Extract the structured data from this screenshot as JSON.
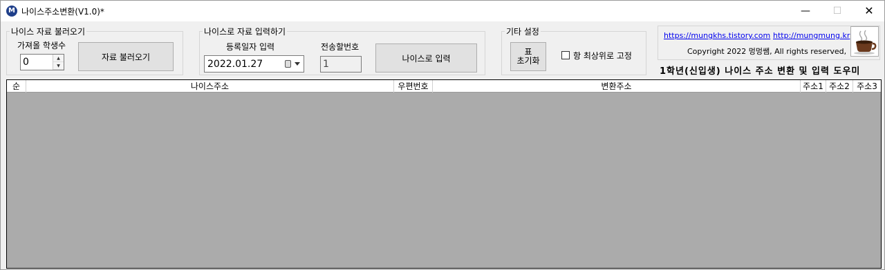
{
  "window": {
    "title": "나이스주소변환(V1.0)*",
    "icon": "app-m-icon"
  },
  "groups": {
    "load": {
      "title": "나이스 자료 불러오기",
      "count_label": "가져올 학생수",
      "count_value": "0",
      "load_button": "자료 불러오기"
    },
    "input": {
      "title": "나이스로 자료 입력하기",
      "date_label": "등록일자 입력",
      "date_value": "2022.01.27",
      "send_label": "전송할번호",
      "send_value": "1",
      "input_button": "나이스로 입력"
    },
    "misc": {
      "title": "기타 설정",
      "reset_button_line1": "표",
      "reset_button_line2": "초기화",
      "topmost_label": "항 최상위로 고정",
      "topmost_checked": false
    }
  },
  "info": {
    "link1": "https://mungkhs.tistory.com",
    "link2": "http://mungmung.kr",
    "copyright": "Copyright 2022 멍멍쌤, All rights reserved,",
    "logo_icon": "coffee-cup-icon"
  },
  "banner": "1학년(신입생) 나이스 주소 변환 및 입력 도우미",
  "table": {
    "columns": [
      "순",
      "나이스주소",
      "우편번호",
      "변환주소",
      "주소1",
      "주소2",
      "주소3"
    ],
    "rows": []
  }
}
